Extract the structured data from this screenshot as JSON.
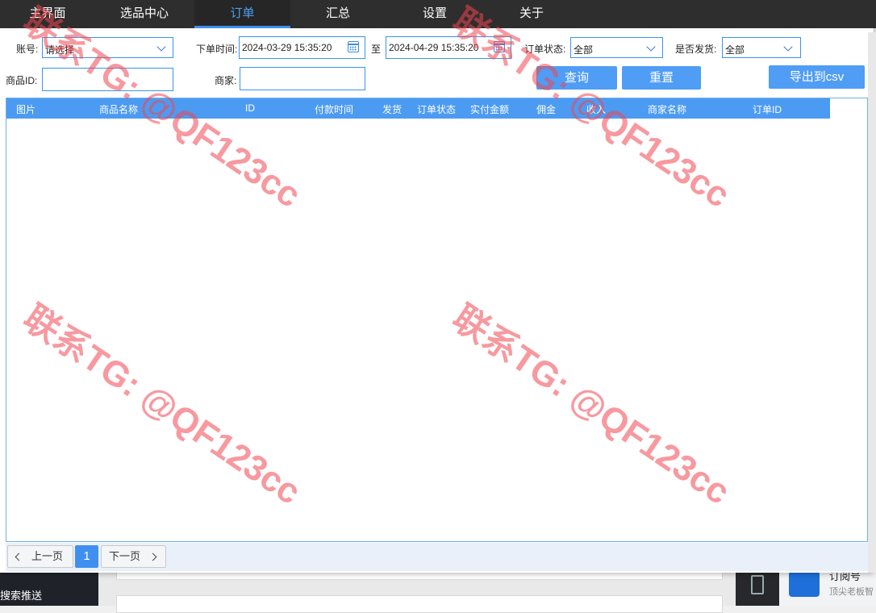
{
  "nav": {
    "tabs": [
      {
        "label": "主界面"
      },
      {
        "label": "选品中心"
      },
      {
        "label": "订单"
      },
      {
        "label": "汇总"
      },
      {
        "label": "设置"
      },
      {
        "label": "关于"
      }
    ],
    "active_tab": "订单"
  },
  "filters": {
    "account_label": "账号:",
    "account_value": "请选择",
    "order_time_label": "下单时间:",
    "start_time": "2024-03-29 15:35:20",
    "to_label": "至",
    "end_time": "2024-04-29 15:35:20",
    "order_status_label": "订单状态:",
    "order_status_value": "全部",
    "shipped_label": "是否发货:",
    "shipped_value": "全部",
    "product_id_label": "商品ID:",
    "product_id_value": "",
    "merchant_label": "商家:",
    "merchant_value": ""
  },
  "buttons": {
    "query": "查询",
    "reset": "重置",
    "export": "导出到csv"
  },
  "table": {
    "columns": [
      "图片",
      "商品名称",
      "ID",
      "付款时间",
      "发货",
      "订单状态",
      "实付金额",
      "佣金",
      "收入",
      "商家名称",
      "订单ID"
    ],
    "rows": []
  },
  "pagination": {
    "prev": "上一页",
    "current": "1",
    "next": "下一页"
  },
  "watermark": "联系TG: @QF123cc",
  "background": {
    "left_text": "搜索推送",
    "sub_title": "订阅号",
    "sub_desc": "顶尖老板智"
  },
  "colors": {
    "accent": "#4c9bf2",
    "nav_bg": "#2e2e2e",
    "watermark": "#f04650"
  }
}
